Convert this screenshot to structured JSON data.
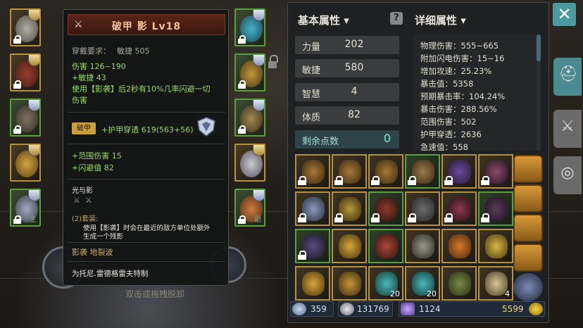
{
  "tooltip": {
    "title": "破甲 影 Lv18",
    "requirement_label": "穿戴要求：",
    "requirement_value": "敏捷 505",
    "damage": "伤害  126~190",
    "agility_bonus": "+敏捷 43",
    "effect_line1": "使用【影袭】后2秒有10%几率闪避一切",
    "effect_line2": "伤害",
    "break_tag": "破甲",
    "armor_pen": "+护甲穿透 619(563+56)",
    "aoe": "+范围伤害 15",
    "dodge": "+闪避值 82",
    "set_name": "光与影",
    "set_count": "(2)套装:",
    "set_desc1": "使用【影袭】时会在最近的敌方单位处额外",
    "set_desc2": "生成一个残影",
    "skills": "影袭  地裂波",
    "made_for": "为托尼.雷德格雷夫特制"
  },
  "basic": {
    "header": "基本属性",
    "stats": [
      {
        "k": "力量",
        "v": "202"
      },
      {
        "k": "敏捷",
        "v": "580"
      },
      {
        "k": "智慧",
        "v": "4"
      },
      {
        "k": "体质",
        "v": "82"
      }
    ],
    "remain_label": "剩余点数",
    "remain_value": "0"
  },
  "detail": {
    "header": "详细属性",
    "lines": [
      "物理伤害：555~665",
      "附加闪电伤害：15~16",
      "增加攻速：25.23%",
      "暴击值：5358",
      "预期暴击率：104.24%",
      "暴击伤害：288.56%",
      "范围伤害：502",
      "护甲穿透：2636",
      "急速值：558"
    ]
  },
  "inventory_counts": {
    "r4c2": "20",
    "r4c3": "20",
    "r4c6": "4"
  },
  "currency": {
    "crystals": "359",
    "silver": "131769",
    "gems": "1124",
    "gold": "5599"
  },
  "hint": "双击或拖拽脱卸",
  "slot_chars": {
    "left": "主",
    "right": "副"
  },
  "close": "✕",
  "colors": {
    "accent": "#4a9aa0",
    "rare": "#b8923a",
    "uncommon": "#5aa03c"
  }
}
